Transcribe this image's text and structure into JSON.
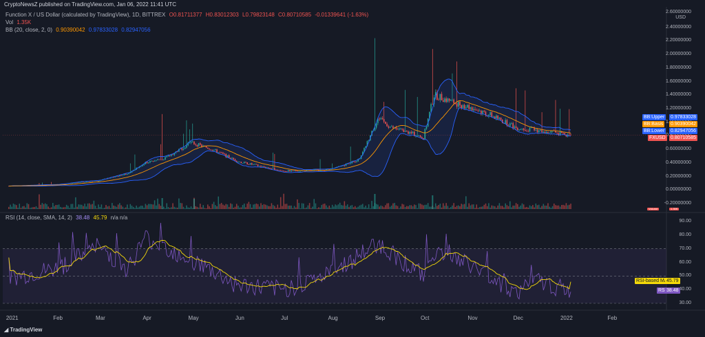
{
  "header": {
    "published": "CryptoNewsZ published on TradingView.com, Jan 06, 2022 11:41 UTC"
  },
  "legend": {
    "symbol": "Function X / US Dollar (calculated by TradingView), 1D, BITTREX",
    "open": "O0.81711377",
    "high": "H0.83012303",
    "low": "L0.79823148",
    "close": "C0.80710585",
    "change": "-0.01339641 (-1.63%)",
    "vol_label": "Vol",
    "vol_value": "1.35K",
    "bb_label": "BB (20, close, 2, 0)",
    "bb_basis": "0.90390042",
    "bb_upper": "0.97833028",
    "bb_lower": "0.82947056",
    "rsi_label": "RSI (14, close, SMA, 14, 2)",
    "rsi_value": "38.48",
    "rsi_ma": "45.79",
    "rsi_na": "n/a n/a"
  },
  "price_axis": {
    "currency": "USD",
    "ticks": [
      "2.60000000",
      "2.40000000",
      "2.20000000",
      "2.00000000",
      "1.80000000",
      "1.60000000",
      "1.40000000",
      "1.20000000",
      "1.00000000",
      "0.80000000",
      "0.60000000",
      "0.40000000",
      "0.20000000",
      "0.00000000",
      "-0.20000000"
    ]
  },
  "price_tags": [
    {
      "label": "BB:Upper",
      "value": "0.97833028",
      "color": "#2962ff"
    },
    {
      "label": "BB:Basis",
      "value": "0.90390042",
      "color": "#ff9800"
    },
    {
      "label": "BB:Lower",
      "value": "0.82947056",
      "color": "#2962ff"
    },
    {
      "label": "FXUSD",
      "value": "0.80710585",
      "color": "#ef5350"
    }
  ],
  "volume_tag": {
    "label": "Volume",
    "value": "1.35K"
  },
  "rsi_axis": {
    "ticks": [
      "90.00",
      "80.00",
      "70.00",
      "60.00",
      "50.00",
      "40.00",
      "30.00"
    ]
  },
  "rsi_tags": [
    {
      "label": "RSI-based MA",
      "value": "45.79",
      "color": "#f5d90a"
    },
    {
      "label": "RSI",
      "value": "38.48",
      "color": "#7e57c2"
    }
  ],
  "time_axis": {
    "labels": [
      "2021",
      "Feb",
      "Mar",
      "Apr",
      "May",
      "Jun",
      "Jul",
      "Aug",
      "Sep",
      "Oct",
      "Nov",
      "Dec",
      "2022",
      "Feb"
    ]
  },
  "footer": {
    "brand": "TradingView"
  },
  "colors": {
    "bg": "#161a25",
    "up": "#26a69a",
    "down": "#ef5350",
    "bb": "#2962ff",
    "basis": "#ff9800",
    "rsi": "#7e57c2",
    "rsi_ma": "#f5d90a"
  },
  "chart_data": {
    "type": "candlestick",
    "price_ylim": [
      -0.2,
      2.6
    ],
    "rsi_ylim": [
      30,
      90
    ],
    "rsi_bands": [
      70,
      50,
      30
    ],
    "close_anchors": [
      {
        "date": "2021-01-01",
        "close": 0.06
      },
      {
        "date": "2021-02-01",
        "close": 0.08
      },
      {
        "date": "2021-03-01",
        "close": 0.14
      },
      {
        "date": "2021-03-20",
        "close": 0.24
      },
      {
        "date": "2021-04-01",
        "close": 0.4
      },
      {
        "date": "2021-04-15",
        "close": 0.48
      },
      {
        "date": "2021-05-01",
        "close": 0.7
      },
      {
        "date": "2021-05-15",
        "close": 0.6
      },
      {
        "date": "2021-06-01",
        "close": 0.42
      },
      {
        "date": "2021-07-01",
        "close": 0.28
      },
      {
        "date": "2021-08-01",
        "close": 0.3
      },
      {
        "date": "2021-08-20",
        "close": 0.45
      },
      {
        "date": "2021-09-01",
        "close": 1.05
      },
      {
        "date": "2021-09-10",
        "close": 0.92
      },
      {
        "date": "2021-10-01",
        "close": 0.78
      },
      {
        "date": "2021-10-08",
        "close": 1.4
      },
      {
        "date": "2021-10-20",
        "close": 1.3
      },
      {
        "date": "2021-11-01",
        "close": 1.22
      },
      {
        "date": "2021-11-15",
        "close": 1.1
      },
      {
        "date": "2021-12-01",
        "close": 0.92
      },
      {
        "date": "2021-12-15",
        "close": 0.88
      },
      {
        "date": "2022-01-06",
        "close": 0.8071
      }
    ],
    "rsi_anchors": [
      {
        "date": "2021-01-01",
        "rsi": 48
      },
      {
        "date": "2021-02-01",
        "rsi": 55
      },
      {
        "date": "2021-03-01",
        "rsi": 72
      },
      {
        "date": "2021-03-20",
        "rsi": 55
      },
      {
        "date": "2021-04-01",
        "rsi": 78
      },
      {
        "date": "2021-05-01",
        "rsi": 62
      },
      {
        "date": "2021-06-01",
        "rsi": 43
      },
      {
        "date": "2021-07-01",
        "rsi": 40
      },
      {
        "date": "2021-08-01",
        "rsi": 52
      },
      {
        "date": "2021-09-01",
        "rsi": 74
      },
      {
        "date": "2021-10-01",
        "rsi": 50
      },
      {
        "date": "2021-10-08",
        "rsi": 68
      },
      {
        "date": "2021-11-01",
        "rsi": 58
      },
      {
        "date": "2021-12-01",
        "rsi": 38
      },
      {
        "date": "2021-12-15",
        "rsi": 46
      },
      {
        "date": "2022-01-06",
        "rsi": 38.48
      }
    ]
  }
}
